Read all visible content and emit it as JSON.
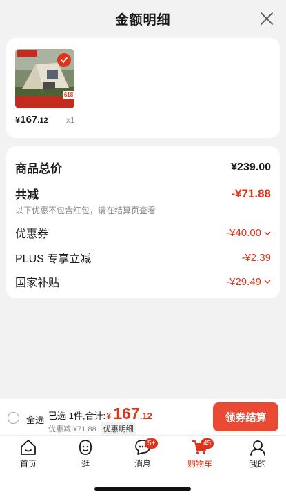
{
  "sheet": {
    "title": "金额明细"
  },
  "product": {
    "price_symbol": "¥",
    "price_int": "167",
    "price_dec": ".12",
    "quantity": "x1",
    "badge_618": "618"
  },
  "summary": {
    "total_label": "商品总价",
    "total_value": "¥239.00",
    "reduce_label": "共减",
    "reduce_value": "-¥71.88",
    "reduce_note": "以下优惠不包含红包，请在结算页查看",
    "items": [
      {
        "label": "优惠券",
        "value": "-¥40.00"
      },
      {
        "label": "PLUS 专享立减",
        "value": "-¥2.39"
      },
      {
        "label": "国家补贴",
        "value": "-¥29.49"
      }
    ]
  },
  "bottom": {
    "select_all": "全选",
    "selected_text": "已选 1件,合计:",
    "total_symbol": "¥",
    "total_int": "167",
    "total_dec": ".12",
    "discount_text": "优惠减:¥71.88",
    "detail_link": "优惠明细",
    "checkout": "领券结算"
  },
  "tabs": [
    {
      "label": "首页",
      "icon": "home-icon"
    },
    {
      "label": "逛",
      "icon": "stroll-icon"
    },
    {
      "label": "消息",
      "icon": "message-icon",
      "badge": "5+"
    },
    {
      "label": "购物车",
      "icon": "cart-icon",
      "badge": "45",
      "active": true
    },
    {
      "label": "我的",
      "icon": "profile-icon"
    }
  ],
  "colors": {
    "accent": "#e2331a",
    "button": "#ea4a34",
    "background": "#f2f2f2"
  }
}
